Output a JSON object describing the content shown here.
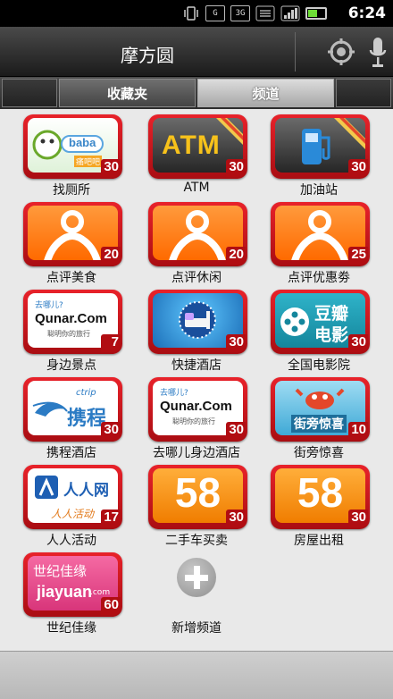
{
  "status_bar": {
    "time": "6:24",
    "icons": [
      "vibrate-icon",
      "g-signal-icon",
      "3g-signal-icon",
      "sync-icon",
      "signal-icon",
      "battery-icon"
    ],
    "icon_glyphs": [
      "G",
      "3G",
      "G"
    ]
  },
  "header": {
    "title": "摩方圆"
  },
  "tabs": [
    {
      "label": "收藏夹",
      "active": false
    },
    {
      "label": "频道",
      "active": true
    }
  ],
  "channels": [
    {
      "label": "找厕所",
      "count": "30",
      "logo": "toilet-logo",
      "logo_text": "baba",
      "logo_sub": "痛吧吧",
      "ribbon": false
    },
    {
      "label": "ATM",
      "count": "30",
      "logo": "atm-logo",
      "logo_text": "ATM",
      "ribbon": true
    },
    {
      "label": "加油站",
      "count": "30",
      "logo": "gas-station-logo",
      "ribbon": true
    },
    {
      "label": "点评美食",
      "count": "20",
      "logo": "dianping-logo"
    },
    {
      "label": "点评休闲",
      "count": "20",
      "logo": "dianping-logo"
    },
    {
      "label": "点评优惠劵",
      "count": "25",
      "logo": "dianping-logo"
    },
    {
      "label": "身边景点",
      "count": "7",
      "logo": "qunar-logo",
      "logo_text": "Qunar.Com",
      "logo_top": "去哪儿?",
      "logo_sub": "聪明你的旅行"
    },
    {
      "label": "快捷酒店",
      "count": "30",
      "logo": "hotel-logo"
    },
    {
      "label": "全国电影院",
      "count": "30",
      "logo": "douban-movie-logo",
      "logo_text": "豆瓣",
      "logo_sub": "电影"
    },
    {
      "label": "携程酒店",
      "count": "30",
      "logo": "ctrip-logo",
      "logo_text": "携程",
      "logo_top": "ctrip"
    },
    {
      "label": "去哪儿身边酒店",
      "count": "30",
      "logo": "qunar-logo",
      "logo_text": "Qunar.Com",
      "logo_top": "去哪儿?",
      "logo_sub": "聪明你的旅行"
    },
    {
      "label": "街旁惊喜",
      "count": "10",
      "logo": "jiepang-logo",
      "logo_text": "街旁惊喜"
    },
    {
      "label": "人人活动",
      "count": "17",
      "logo": "renren-logo",
      "logo_text": "人人网",
      "logo_sub": "人人活动"
    },
    {
      "label": "二手车买卖",
      "count": "30",
      "logo": "58-logo",
      "logo_text": "58"
    },
    {
      "label": "房屋出租",
      "count": "30",
      "logo": "58-logo",
      "logo_text": "58"
    },
    {
      "label": "世纪佳缘",
      "count": "60",
      "logo": "jiayuan-logo",
      "logo_text": "世纪佳缘",
      "logo_sub": "jiayuan",
      "logo_sub2": ".com"
    }
  ],
  "add_channel": {
    "label": "新增频道"
  },
  "colors": {
    "frame_red": "#d71a20",
    "count_red": "#b10d12",
    "dianping_orange": "#ff7a12",
    "background": "#e9e9e9"
  }
}
